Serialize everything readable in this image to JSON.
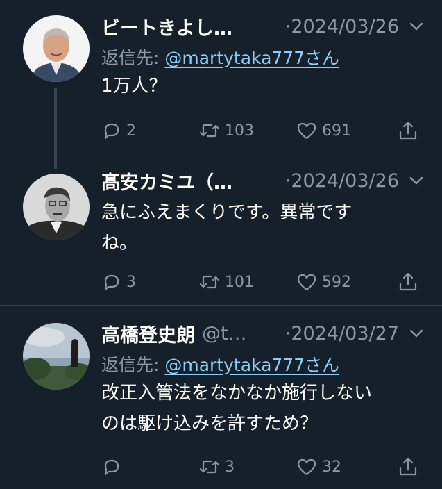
{
  "tweets": [
    {
      "name": "ビートきよし…",
      "handle": "",
      "dot": "·",
      "date": "2024/03/26",
      "reply_prefix": "返信先: ",
      "reply_mention": "@martytaka777さん",
      "text_lines": [
        "1万人？"
      ],
      "replies": "2",
      "retweets": "103",
      "likes": "691"
    },
    {
      "name": "髙安カミユ（…",
      "handle": "",
      "dot": "·",
      "date": "2024/03/26",
      "text_lines": [
        "急にふえまくりです。異常です",
        "ね。"
      ],
      "replies": "3",
      "retweets": "101",
      "likes": "592"
    },
    {
      "name": "高橋登史朗",
      "handle": "@t…",
      "dot": "·",
      "date": "2024/03/27",
      "reply_prefix": "返信先: ",
      "reply_mention": "@martytaka777さん",
      "text_lines": [
        "改正入管法をなかなか施行しない",
        "のは駆け込みを許すため？"
      ],
      "replies": "",
      "retweets": "3",
      "likes": "32"
    }
  ],
  "icons": [
    "reply-icon",
    "retweet-icon",
    "like-icon",
    "share-icon",
    "chevron-down-icon"
  ],
  "colors": {
    "background": "#15202b",
    "secondary": "#8b98a5",
    "link": "#8ecdf8",
    "divider": "#38444d"
  }
}
